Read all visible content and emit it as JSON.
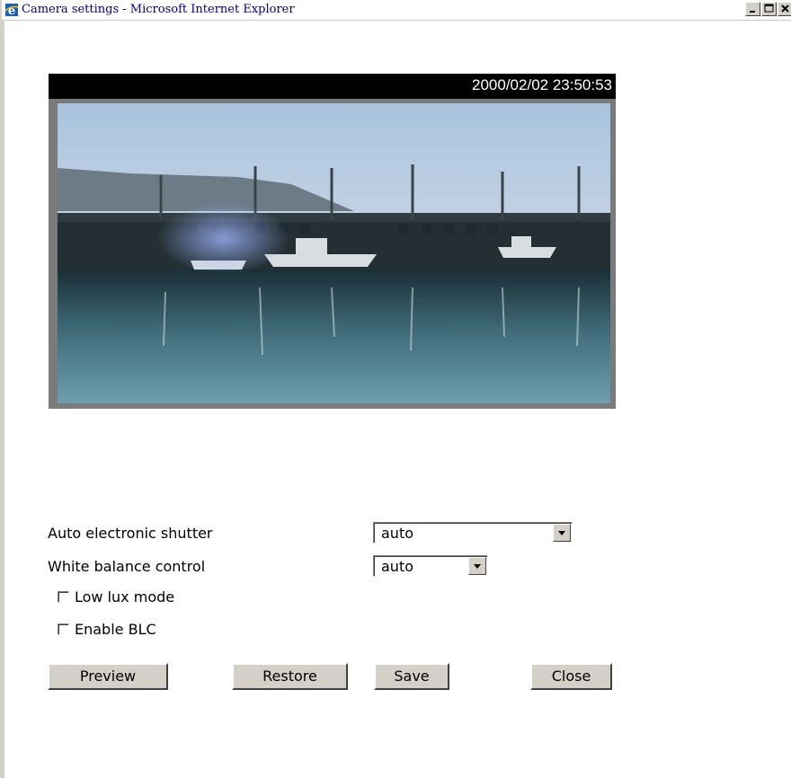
{
  "window": {
    "title": "Camera settings - Microsoft Internet Explorer",
    "icon": "ie-icon",
    "controls": [
      "minimize",
      "maximize",
      "close"
    ]
  },
  "video": {
    "timestamp": "2000/02/02 23:50:53",
    "description_icon": "camera-view"
  },
  "settings": {
    "shutter_label": "Auto electronic shutter",
    "shutter_value": "auto",
    "white_balance_label": "White balance control",
    "white_balance_value": "auto",
    "low_lux_label": "Low lux mode",
    "low_lux_checked": false,
    "blc_label": "Enable BLC",
    "blc_checked": false
  },
  "buttons": {
    "preview": "Preview",
    "restore": "Restore",
    "save": "Save",
    "close": "Close"
  },
  "colors": {
    "titlebar_text": "#000080",
    "button_face": "#d4d0c8",
    "timestamp_bg": "#000000"
  }
}
